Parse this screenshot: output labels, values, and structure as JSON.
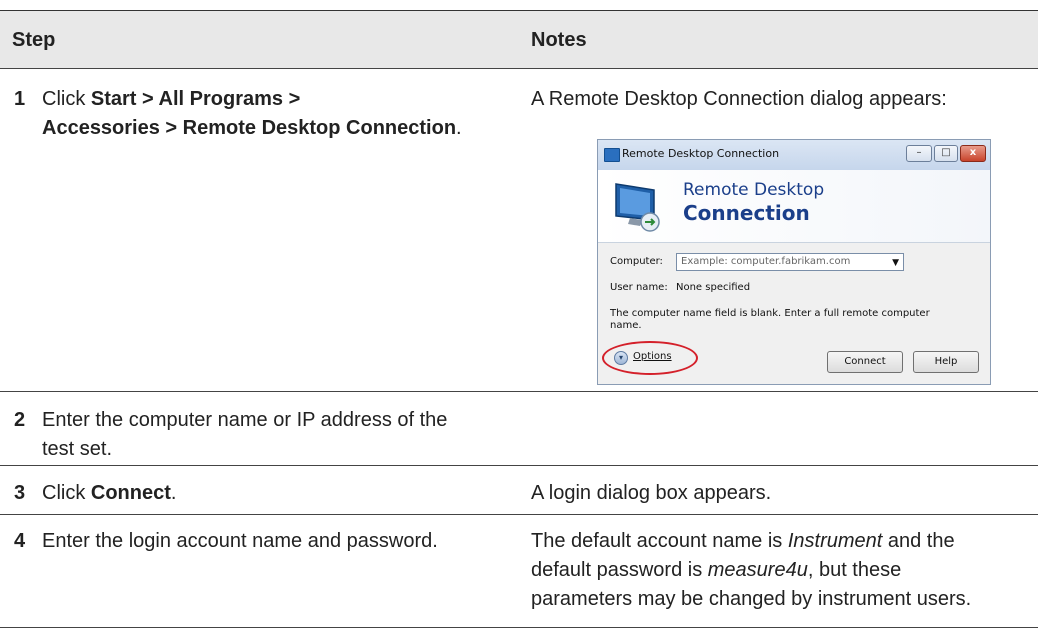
{
  "header": {
    "step": "Step",
    "notes": "Notes"
  },
  "rows": [
    {
      "num": "1",
      "step_prefix": "Click ",
      "step_path_1": "Start",
      "sep1": " > ",
      "step_path_2": "All Programs",
      "sep2": " > ",
      "step_path_3": "Accessories",
      "sep3": " > ",
      "step_path_4": "Remote Desktop Connection",
      "step_suffix": ".",
      "note": "A Remote Desktop Connection dialog appears:"
    },
    {
      "num": "2",
      "step_line1": "Enter the computer name or IP address of the",
      "step_line2": "test set.",
      "note": ""
    },
    {
      "num": "3",
      "step_prefix": "Click ",
      "step_bold": "Connect",
      "step_suffix": ".",
      "note": "A login dialog box appears."
    },
    {
      "num": "4",
      "step": "Enter the login account name and password.",
      "note_a": "The default account name is ",
      "note_account": "Instrument",
      "note_b": " and the",
      "note_c": "default password is ",
      "note_password": "measure4u",
      "note_d": ", but these",
      "note_e": "parameters may be changed by instrument users."
    }
  ],
  "dialog": {
    "title": "Remote Desktop Connection",
    "banner_line1": "Remote Desktop",
    "banner_line2": "Connection",
    "computer_label": "Computer:",
    "computer_placeholder": "Example: computer.fabrikam.com",
    "username_label": "User name:",
    "username_value": "None specified",
    "message_line1": "The computer name field is blank. Enter a full remote computer",
    "message_line2": "name.",
    "options_label": "Options",
    "connect_label": "Connect",
    "help_label": "Help",
    "minimize_glyph": "–",
    "maximize_glyph": "□",
    "close_glyph": "x",
    "dropdown_glyph": "▼",
    "options_glyph": "▾"
  },
  "colors": {
    "header_band": "#e8e8e8",
    "banner_text": "#1b3f8a",
    "highlight": "#d4202a"
  }
}
